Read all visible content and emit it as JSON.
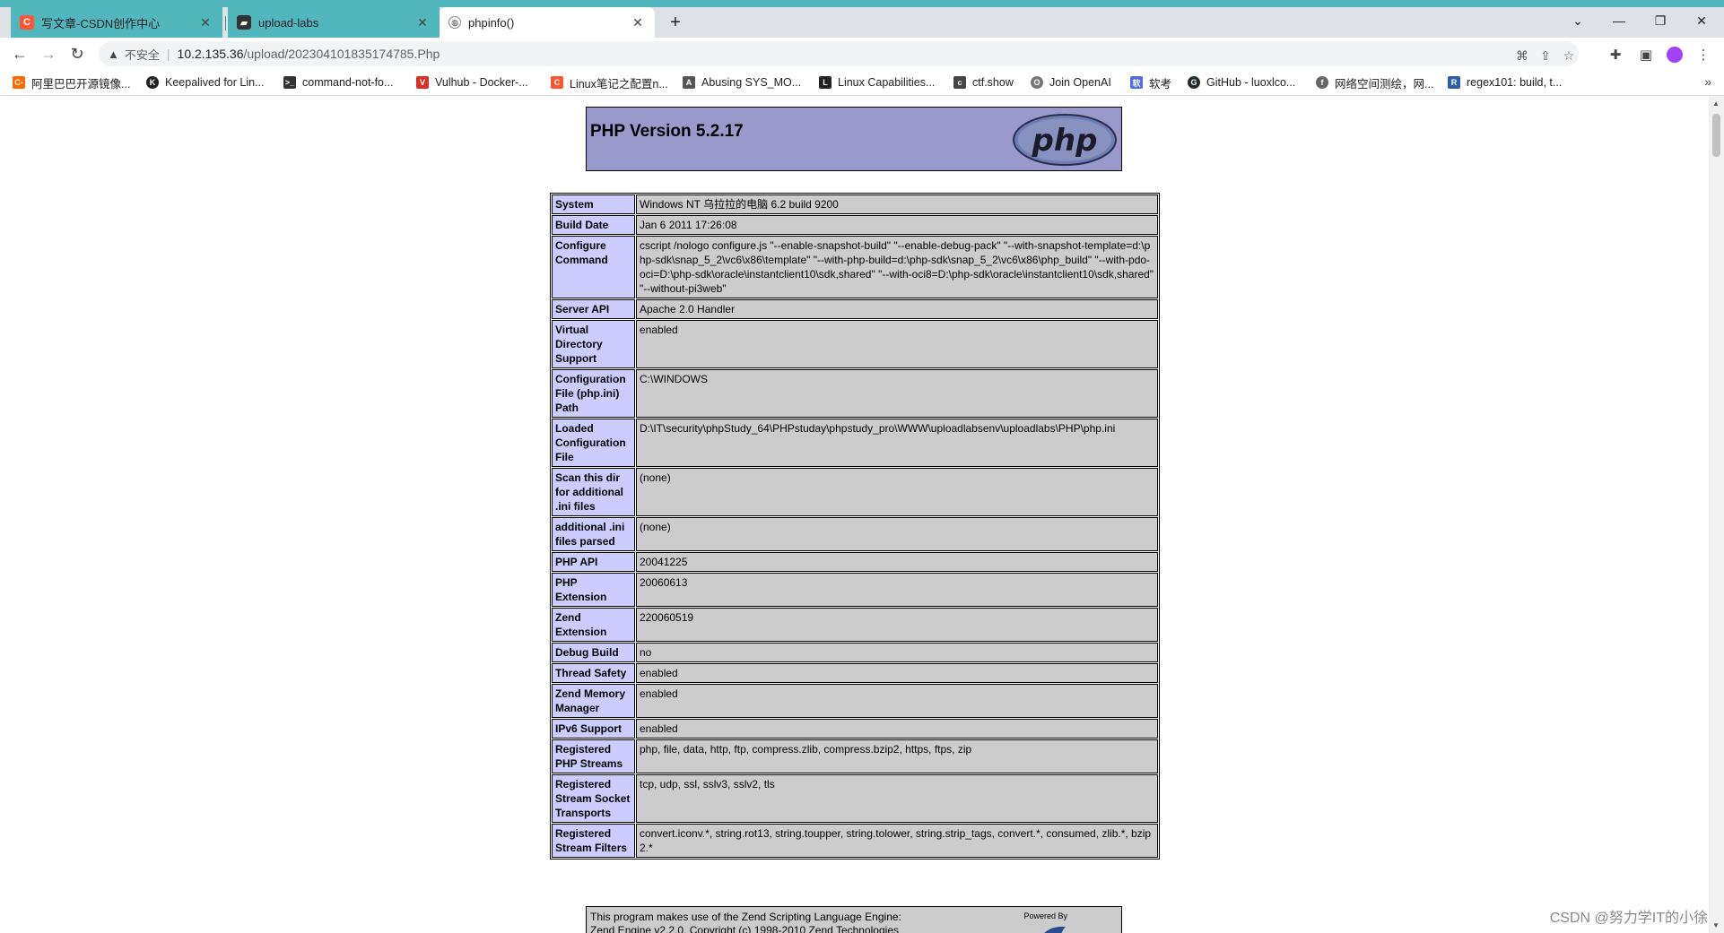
{
  "browser": {
    "tabs": [
      {
        "title": "写文章-CSDN创作中心",
        "icon": "csdn-icon",
        "state": "inactive"
      },
      {
        "title": "upload-labs",
        "icon": "folder-icon",
        "state": "inactive"
      },
      {
        "title": "phpinfo()",
        "icon": "globe-icon",
        "state": "active"
      }
    ],
    "address": {
      "security_label": "不安全",
      "host": "10.2.135.36",
      "path": "/upload/202304101835174785.Php"
    },
    "bookmarks": [
      {
        "label": "阿里巴巴开源镜像...",
        "color": "#ff6a00",
        "icon_text": "C-"
      },
      {
        "label": "Keepalived for Lin...",
        "color": "#222222",
        "icon_text": "K"
      },
      {
        "label": "command-not-fo...",
        "color": "#333333",
        "icon_text": ">_"
      },
      {
        "label": "Vulhub - Docker-...",
        "color": "#d93025",
        "icon_text": "V"
      },
      {
        "label": "Linux笔记之配置n...",
        "color": "#fc5531",
        "icon_text": "C"
      },
      {
        "label": "Abusing SYS_MO...",
        "color": "#555555",
        "icon_text": "A"
      },
      {
        "label": "Linux Capabilities...",
        "color": "#222222",
        "icon_text": "L"
      },
      {
        "label": "ctf.show",
        "color": "#444444",
        "icon_text": "c"
      },
      {
        "label": "Join OpenAI",
        "color": "#777777",
        "icon_text": "O"
      },
      {
        "label": "软考",
        "color": "#4f6bed",
        "icon_text": "软"
      },
      {
        "label": "GitHub - luoxlco...",
        "color": "#24292e",
        "icon_text": "G"
      },
      {
        "label": "网络空间测绘，网...",
        "color": "#666666",
        "icon_text": "f"
      },
      {
        "label": "regex101: build, t...",
        "color": "#2d5fa8",
        "icon_text": "R"
      }
    ]
  },
  "phpinfo": {
    "version_title": "PHP Version 5.2.17",
    "logo_text": "php",
    "rows": [
      {
        "name": "System",
        "value": "Windows NT 乌拉拉的电脑 6.2 build 9200"
      },
      {
        "name": "Build Date",
        "value": "Jan 6 2011 17:26:08"
      },
      {
        "name": "Configure Command",
        "value": "cscript /nologo configure.js \"--enable-snapshot-build\" \"--enable-debug-pack\" \"--with-snapshot-template=d:\\php-sdk\\snap_5_2\\vc6\\x86\\template\" \"--with-php-build=d:\\php-sdk\\snap_5_2\\vc6\\x86\\php_build\" \"--with-pdo-oci=D:\\php-sdk\\oracle\\instantclient10\\sdk,shared\" \"--with-oci8=D:\\php-sdk\\oracle\\instantclient10\\sdk,shared\" \"--without-pi3web\""
      },
      {
        "name": "Server API",
        "value": "Apache 2.0 Handler"
      },
      {
        "name": "Virtual Directory Support",
        "value": "enabled"
      },
      {
        "name": "Configuration File (php.ini) Path",
        "value": "C:\\WINDOWS"
      },
      {
        "name": "Loaded Configuration File",
        "value": "D:\\IT\\security\\phpStudy_64\\PHPstuday\\phpstudy_pro\\WWW\\uploadlabsenv\\uploadlabs\\PHP\\php.ini"
      },
      {
        "name": "Scan this dir for additional .ini files",
        "value": "(none)"
      },
      {
        "name": "additional .ini files parsed",
        "value": "(none)"
      },
      {
        "name": "PHP API",
        "value": "20041225"
      },
      {
        "name": "PHP Extension",
        "value": "20060613"
      },
      {
        "name": "Zend Extension",
        "value": "220060519"
      },
      {
        "name": "Debug Build",
        "value": "no"
      },
      {
        "name": "Thread Safety",
        "value": "enabled"
      },
      {
        "name": "Zend Memory Manager",
        "value": "enabled"
      },
      {
        "name": "IPv6 Support",
        "value": "enabled"
      },
      {
        "name": "Registered PHP Streams",
        "value": "php, file, data, http, ftp, compress.zlib, compress.bzip2, https, ftps, zip"
      },
      {
        "name": "Registered Stream Socket Transports",
        "value": "tcp, udp, ssl, sslv3, sslv2, tls"
      },
      {
        "name": "Registered Stream Filters",
        "value": "convert.iconv.*, string.rot13, string.toupper, string.tolower, string.strip_tags, convert.*, consumed, zlib.*, bzip2.*"
      }
    ],
    "zend_line1": "This program makes use of the Zend Scripting Language Engine:",
    "zend_line2": "Zend Engine v2.2.0, Copyright (c) 1998-2010 Zend Technologies",
    "powered_by": "Powered By"
  },
  "watermark": "CSDN @努力学IT的小徐",
  "colors": {
    "tab_accent": "#52b7bd",
    "php_header": "#9999cc",
    "label_cell": "#ccccff",
    "value_cell": "#cccccc"
  }
}
